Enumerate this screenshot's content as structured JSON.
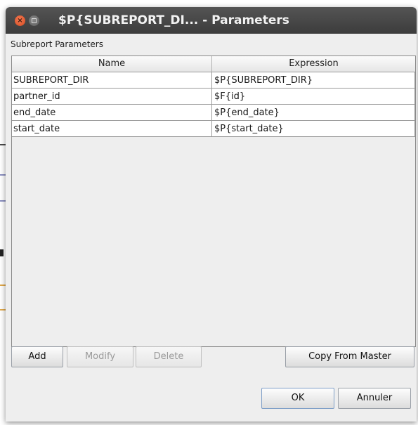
{
  "window": {
    "title": "$P{SUBREPORT_DI... - Parameters",
    "close_glyph": "×"
  },
  "section_label": "Subreport Parameters",
  "table": {
    "columns": [
      "Name",
      "Expression"
    ],
    "rows": [
      {
        "name": "SUBREPORT_DIR",
        "expression": "$P{SUBREPORT_DIR}"
      },
      {
        "name": "partner_id",
        "expression": "$F{id}"
      },
      {
        "name": "end_date",
        "expression": "$P{end_date}"
      },
      {
        "name": "start_date",
        "expression": "$P{start_date}"
      }
    ]
  },
  "buttons": {
    "add": "Add",
    "modify": "Modify",
    "delete": "Delete",
    "copy_from_master": "Copy From Master",
    "ok": "OK",
    "cancel": "Annuler"
  },
  "colors": {
    "title_bar": "#3c3c3c",
    "close_button": "#d94b1f",
    "dialog_bg": "#eeeeee"
  }
}
